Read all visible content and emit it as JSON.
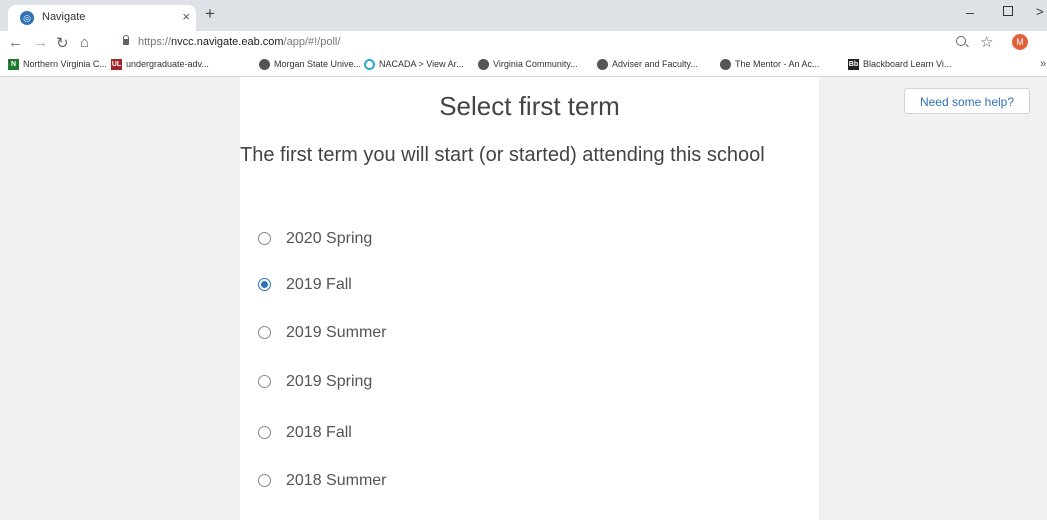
{
  "browser": {
    "tab_title": "Navigate",
    "tab_close": "×",
    "new_tab": "+",
    "url_prefix": "https://",
    "url_domain": "nvcc.navigate.eab.com",
    "url_path": "/app/#!/poll/",
    "avatar_letter": "M",
    "bookmarks": [
      {
        "label": "Northern Virginia C...",
        "icon": "N",
        "color": "#1e7a2f"
      },
      {
        "label": "undergraduate-adv...",
        "icon": "UL",
        "color": "#a3262a"
      },
      {
        "label": "Morgan State Unive...",
        "icon": "globe",
        "color": "#555555"
      },
      {
        "label": "NACADA > View Ar...",
        "icon": "ring",
        "color": "#2ea6d9"
      },
      {
        "label": "Virginia Community...",
        "icon": "globe",
        "color": "#555555"
      },
      {
        "label": "Adviser and Faculty...",
        "icon": "globe",
        "color": "#555555"
      },
      {
        "label": "The Mentor - An Ac...",
        "icon": "globe",
        "color": "#555555"
      },
      {
        "label": "Blackboard Learn Vi...",
        "icon": "Bb",
        "color": "#222222"
      }
    ]
  },
  "page": {
    "title": "Select first term",
    "subtitle": "The first term you will start (or started) attending this school",
    "help_button": "Need some help?",
    "options": [
      {
        "label": "2020 Spring",
        "checked": false
      },
      {
        "label": "2019 Fall",
        "checked": true
      },
      {
        "label": "2019 Summer",
        "checked": false
      },
      {
        "label": "2019 Spring",
        "checked": false
      },
      {
        "label": "2018 Fall",
        "checked": false
      },
      {
        "label": "2018 Summer",
        "checked": false
      }
    ]
  },
  "colors": {
    "accent": "#2f72b8",
    "background": "#f1f1f2"
  }
}
